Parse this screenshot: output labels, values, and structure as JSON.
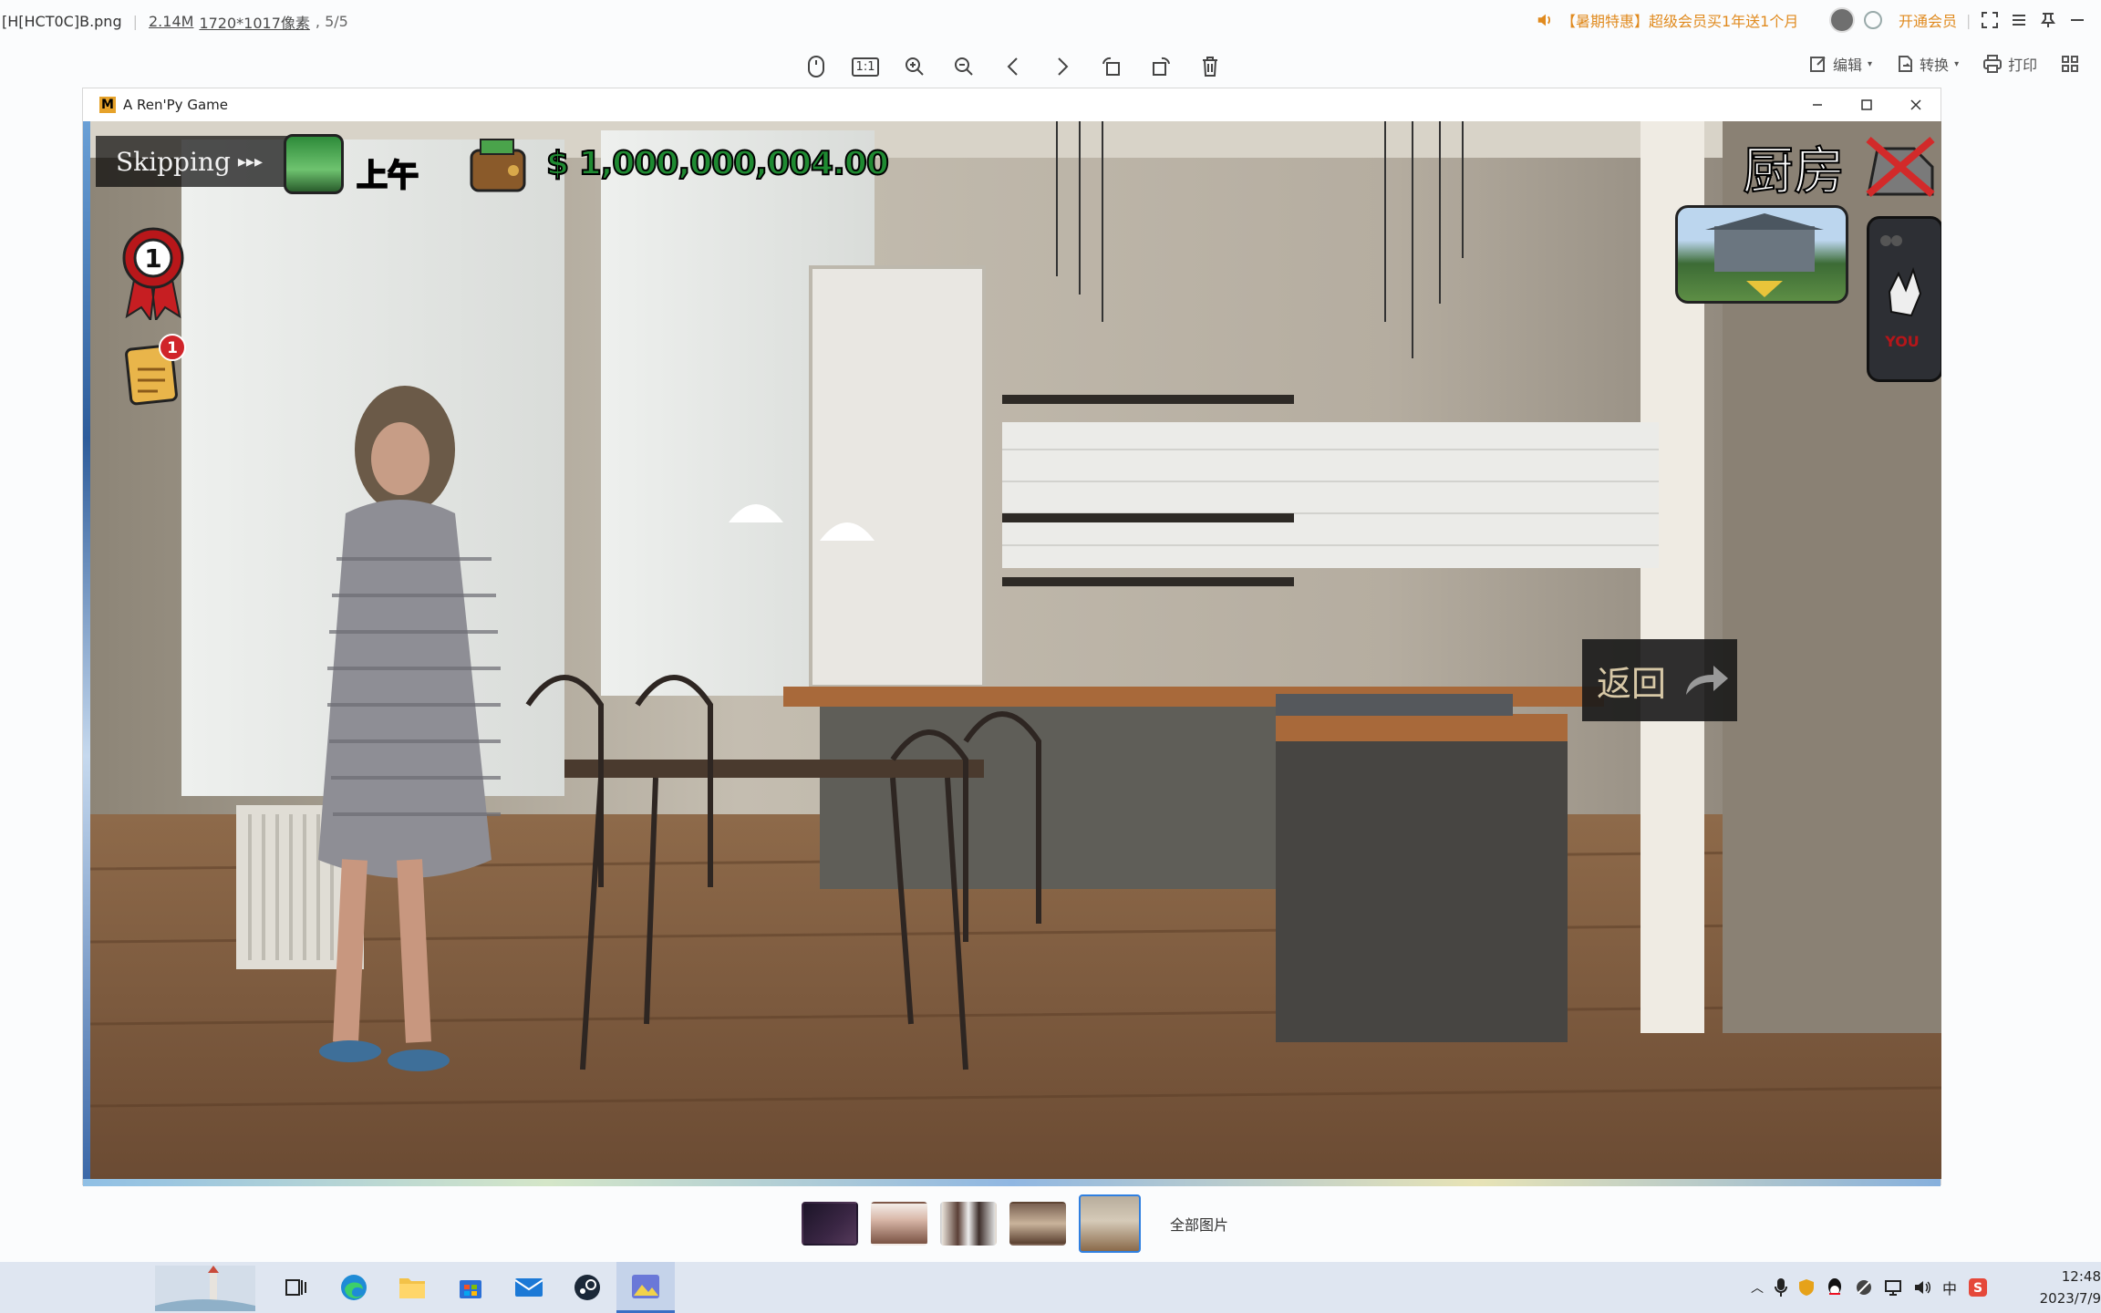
{
  "topbar": {
    "filename": "[H[HCT0C]B.png",
    "filesize": "2.14M",
    "dimensions": "1720*1017像素",
    "page_indicator": "5/5",
    "promo_text": "【暑期特惠】超级会员买1年送1个月",
    "vip_label": "开通会员"
  },
  "toolbar": {
    "fit_label": "1:1",
    "edit_label": "编辑",
    "convert_label": "转换",
    "print_label": "打印"
  },
  "game_window": {
    "title": "A Ren'Py Game",
    "logo_letter": "M"
  },
  "game_hud": {
    "skipping_text": "Skipping",
    "skipping_arrows": "▸▸▸",
    "time_of_day": "上午",
    "money": "$ 1,000,000,004.00",
    "medal_number": "1",
    "notes_badge": "1",
    "location": "厨房",
    "back_button": "返回"
  },
  "thumbnails": {
    "all_label": "全部图片",
    "count": 5,
    "selected_index": 4
  },
  "taskbar": {
    "time": "12:48",
    "date": "2023/7/9",
    "ime": "中"
  }
}
